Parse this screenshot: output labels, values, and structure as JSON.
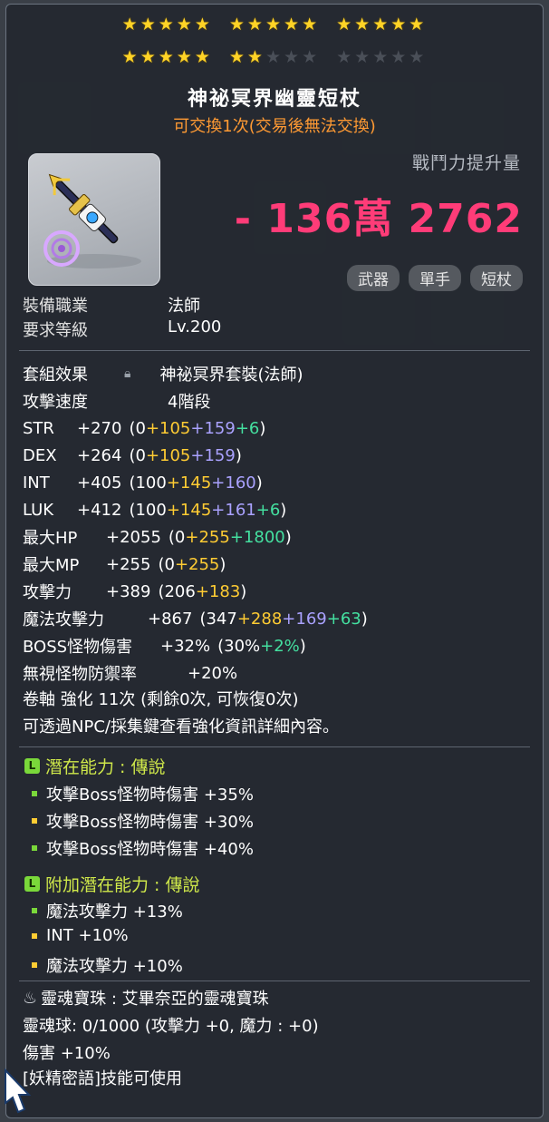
{
  "stars": {
    "rows": [
      [
        {
          "filled": 5,
          "total": 5
        },
        {
          "filled": 5,
          "total": 5
        },
        {
          "filled": 5,
          "total": 5
        }
      ],
      [
        {
          "filled": 5,
          "total": 5
        },
        {
          "filled": 2,
          "total": 5
        },
        {
          "filled": 0,
          "total": 5
        }
      ]
    ]
  },
  "item": {
    "name": "神祕冥界幽靈短杖",
    "trade_note": "可交換1次(交易後無法交換)",
    "icon": "mystic-short-wand-icon"
  },
  "power": {
    "label": "戰鬥力提升量",
    "value": "- 136萬 2762",
    "color": "#ff3c78"
  },
  "tags": [
    "武器",
    "單手",
    "短杖"
  ],
  "requirements": [
    {
      "key": "裝備職業",
      "value": "法師"
    },
    {
      "key": "要求等級",
      "value": "Lv.200"
    }
  ],
  "set_effect": {
    "key": "套組效果",
    "value": "神祕冥界套裝(法師)"
  },
  "attack_speed": {
    "key": "攻擊速度",
    "value": "4階段"
  },
  "stats": [
    {
      "key": "STR",
      "total": "+270",
      "base": "(0",
      "yellow": "+105",
      "purple": "+159",
      "green": "+6",
      "end": ")"
    },
    {
      "key": "DEX",
      "total": "+264",
      "base": "(0",
      "yellow": "+105",
      "purple": "+159",
      "green": "",
      "end": ")"
    },
    {
      "key": "INT",
      "total": "+405",
      "base": "(100",
      "yellow": "+145",
      "purple": "+160",
      "green": "",
      "end": ")"
    },
    {
      "key": "LUK",
      "total": "+412",
      "base": "(100",
      "yellow": "+145",
      "purple": "+161",
      "green": "+6",
      "end": ")"
    },
    {
      "key": "最大HP",
      "total": "+2055",
      "base": "(0",
      "yellow": "+255",
      "purple": "",
      "green": "+1800",
      "end": ")"
    },
    {
      "key": "最大MP",
      "total": "+255",
      "base": "(0",
      "yellow": "+255",
      "purple": "",
      "green": "",
      "end": ")"
    },
    {
      "key": "攻擊力",
      "total": "+389",
      "base": "(206",
      "yellow": "+183",
      "purple": "",
      "green": "",
      "end": ")"
    },
    {
      "key": "魔法攻擊力",
      "total": "+867",
      "base": "(347",
      "yellow": "+288",
      "purple": "+169",
      "green": "+63",
      "end": ")"
    },
    {
      "key": "BOSS怪物傷害",
      "total": "+32%",
      "base": "(30%",
      "yellow": "",
      "purple": "",
      "green": "+2%",
      "end": ")"
    },
    {
      "key": "無視怪物防禦率",
      "total": "+20%",
      "base": "",
      "yellow": "",
      "purple": "",
      "green": "",
      "end": ""
    }
  ],
  "upgrade": {
    "text": "卷軸 強化 11次 (剩餘0次, 可恢復0次)",
    "note": "可透過NPC/採集鍵查看強化資訊詳細內容。"
  },
  "potential": {
    "title": "潛在能力 : 傳說",
    "badge": "L",
    "lines": [
      "攻擊Boss怪物時傷害 +35%",
      "攻擊Boss怪物時傷害 +30%",
      "攻擊Boss怪物時傷害 +40%"
    ]
  },
  "bonus_potential": {
    "title": "附加潛在能力 : 傳說",
    "badge": "L",
    "lines": [
      "魔法攻擊力 +13%",
      "INT +10%",
      "魔法攻擊力 +10%"
    ]
  },
  "soul": {
    "title": "靈魂寶珠 : 艾畢奈亞的靈魂寶珠",
    "orb": "靈魂球:  0/1000 (攻擊力 +0, 魔力 : +0)",
    "damage": "傷害 +10%",
    "skill": "[妖精密語]技能可使用"
  }
}
